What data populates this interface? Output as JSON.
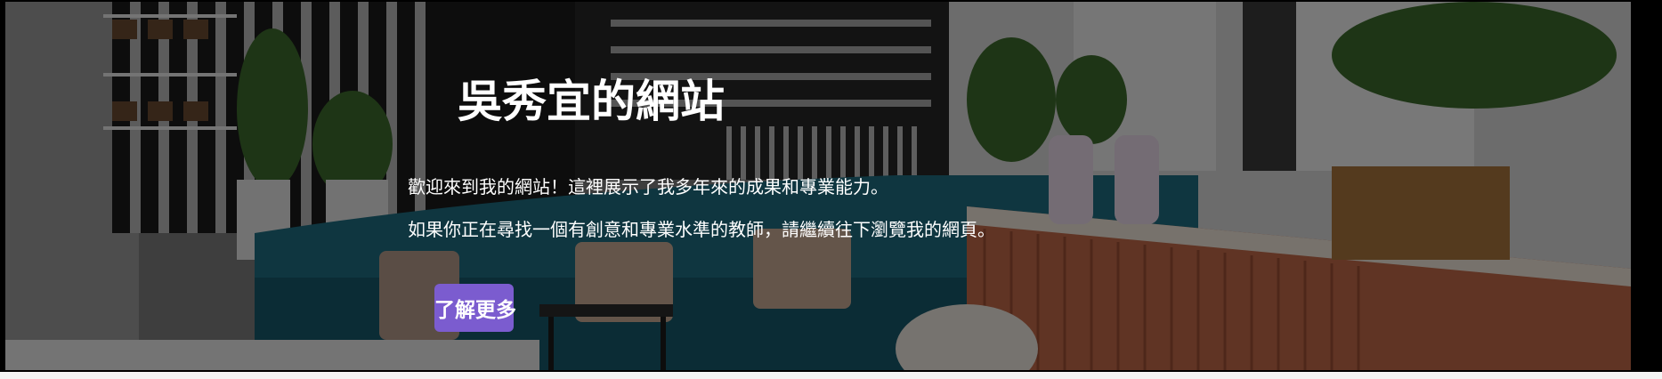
{
  "hero": {
    "title": "吳秀宜的網站",
    "paragraphs": [
      "歡迎來到我的網站！這裡展示了我多年來的成果和專業能力。",
      "如果你正在尋找一個有創意和專業水準的教師，請繼續往下瀏覽我的網頁。"
    ],
    "cta_label": "了解更多",
    "background_image": "office-lounge-photo",
    "colors": {
      "button": "#7b5ccf",
      "text": "#ffffff",
      "overlay": "rgba(0,0,0,0.5)"
    }
  }
}
